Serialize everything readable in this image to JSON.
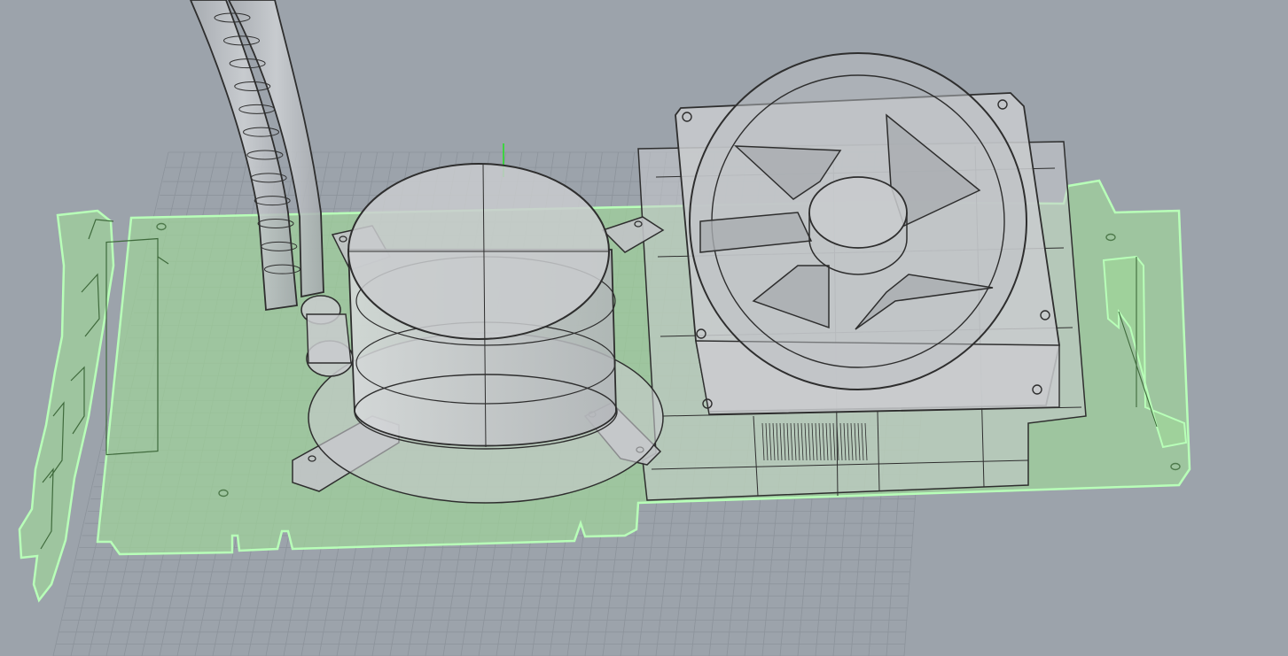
{
  "viewport": {
    "background_color": "#9ca3ab",
    "grid_color": "#8c939b",
    "pcb_fill_color": "#9fd39a",
    "pcb_edge_color": "#b8ffb8",
    "part_fill_color": "#c9cbce",
    "part_edge_color": "#2e2e2e",
    "axis_green_color": "#1fe31f"
  },
  "scene": {
    "components": [
      "pcb-board-icon",
      "io-bracket-icon",
      "water-pump-block-icon",
      "coolant-tube-icon",
      "mounting-bracket-icon",
      "fan-frame-icon",
      "fan-blade-icon",
      "heatsink-icon",
      "pcie-connector-icon"
    ]
  }
}
